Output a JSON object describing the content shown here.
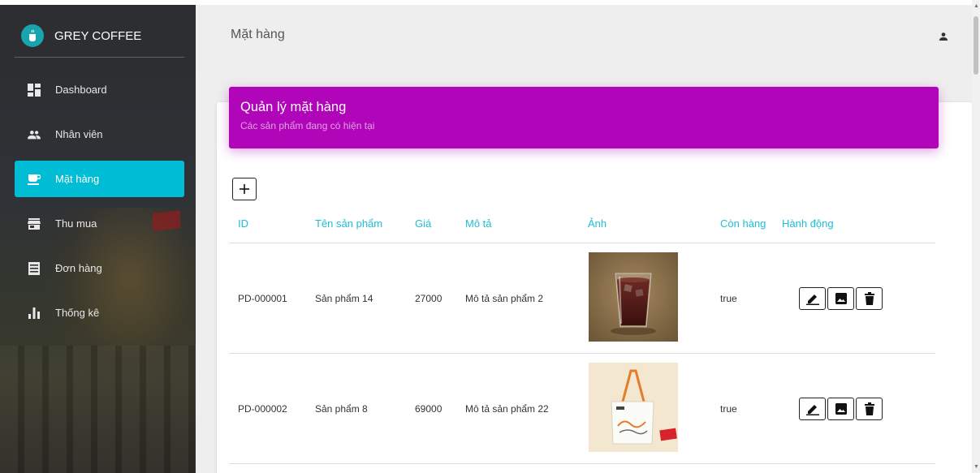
{
  "brand": {
    "name": "GREY COFFEE",
    "logo_icon": "coffee-cup-icon",
    "logo_color": "#18a3ad"
  },
  "sidebar": {
    "items": [
      {
        "label": "Dashboard",
        "icon": "dashboard-icon",
        "active": false
      },
      {
        "label": "Nhân viên",
        "icon": "people-icon",
        "active": false
      },
      {
        "label": "Mặt hàng",
        "icon": "coffee-icon",
        "active": true
      },
      {
        "label": "Thu mua",
        "icon": "store-icon",
        "active": false
      },
      {
        "label": "Đơn hàng",
        "icon": "list-icon",
        "active": false
      },
      {
        "label": "Thống kê",
        "icon": "bar-chart-icon",
        "active": false
      }
    ],
    "active_color": "#00bcd4"
  },
  "topbar": {
    "title": "Mặt hàng",
    "user_icon": "person-icon"
  },
  "card": {
    "title": "Quản lý mặt hàng",
    "subtitle": "Các sản phẩm đang có hiện tại",
    "header_color": "#b005b8",
    "add_label": "+"
  },
  "table": {
    "columns": [
      "ID",
      "Tên sản phẩm",
      "Giá",
      "Mô tả",
      "Ảnh",
      "Còn hàng",
      "Hành động"
    ],
    "header_color": "#1ebdd6",
    "rows": [
      {
        "id": "PD-000001",
        "name": "Sản phẩm 14",
        "price": "27000",
        "description": "Mô tả sản phẩm 2",
        "image": "iced-coffee-glass",
        "in_stock": "true"
      },
      {
        "id": "PD-000002",
        "name": "Sản phẩm 8",
        "price": "69000",
        "description": "Mô tả sản phẩm 22",
        "image": "coffee-bag-new",
        "in_stock": "true"
      }
    ],
    "row_actions": [
      "edit-icon",
      "image-icon",
      "delete-icon"
    ]
  }
}
